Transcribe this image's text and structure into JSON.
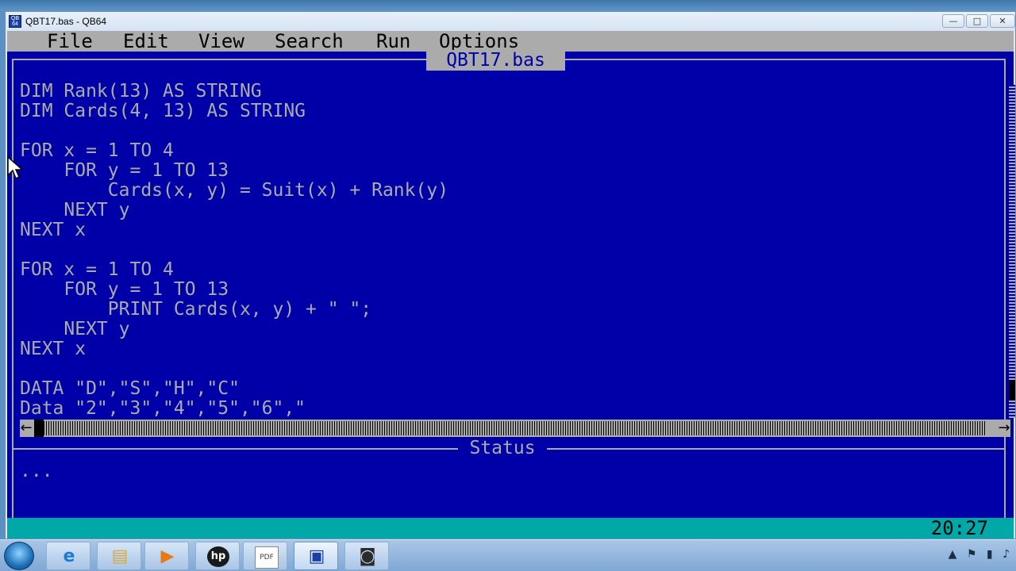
{
  "window": {
    "title": "QBT17.bas - QB64",
    "icon_label": "QB 64",
    "buttons": {
      "minimize": "—",
      "maximize": "□",
      "close": "✕"
    }
  },
  "menu": [
    {
      "label": "File"
    },
    {
      "label": "Edit"
    },
    {
      "label": "View"
    },
    {
      "label": "Search"
    },
    {
      "label": "Run"
    },
    {
      "label": "Options"
    }
  ],
  "editor": {
    "filename": "QBT17.bas",
    "lines": [
      "DIM Rank(13) AS STRING",
      "DIM Cards(4, 13) AS STRING",
      "",
      "FOR x = 1 TO 4",
      "    FOR y = 1 TO 13",
      "        Cards(x, y) = Suit(x) + Rank(y)",
      "    NEXT y",
      "NEXT x",
      "",
      "FOR x = 1 TO 4",
      "    FOR y = 1 TO 13",
      "        PRINT Cards(x, y) + \" \";",
      "    NEXT y",
      "NEXT x",
      "",
      "DATA \"D\",\"S\",\"H\",\"C\"",
      "Data \"2\",\"3\",\"4\",\"5\",\"6\",\""
    ],
    "scroll_arrows": {
      "left": "←",
      "right": "→"
    }
  },
  "status": {
    "title": "Status",
    "text": "..."
  },
  "position_indicator": "20:27",
  "taskbar": {
    "items": [
      {
        "icon": "internet-explorer-icon",
        "glyph": "e"
      },
      {
        "icon": "file-explorer-icon",
        "glyph": "▤"
      },
      {
        "icon": "media-player-icon",
        "glyph": "▶"
      },
      {
        "icon": "hp-icon",
        "glyph": "hp"
      },
      {
        "icon": "pdf-document-icon",
        "glyph": "PDF"
      },
      {
        "icon": "qb64-icon",
        "glyph": "▣"
      },
      {
        "icon": "camera-icon",
        "glyph": "◙"
      }
    ],
    "tray": {
      "arrow": "▲",
      "flag": "⚑",
      "network": "▮",
      "volume": "♪"
    }
  },
  "colors": {
    "qb_background": "#0000a8",
    "qb_text": "#ababab",
    "status_bar": "#00a8a8"
  }
}
